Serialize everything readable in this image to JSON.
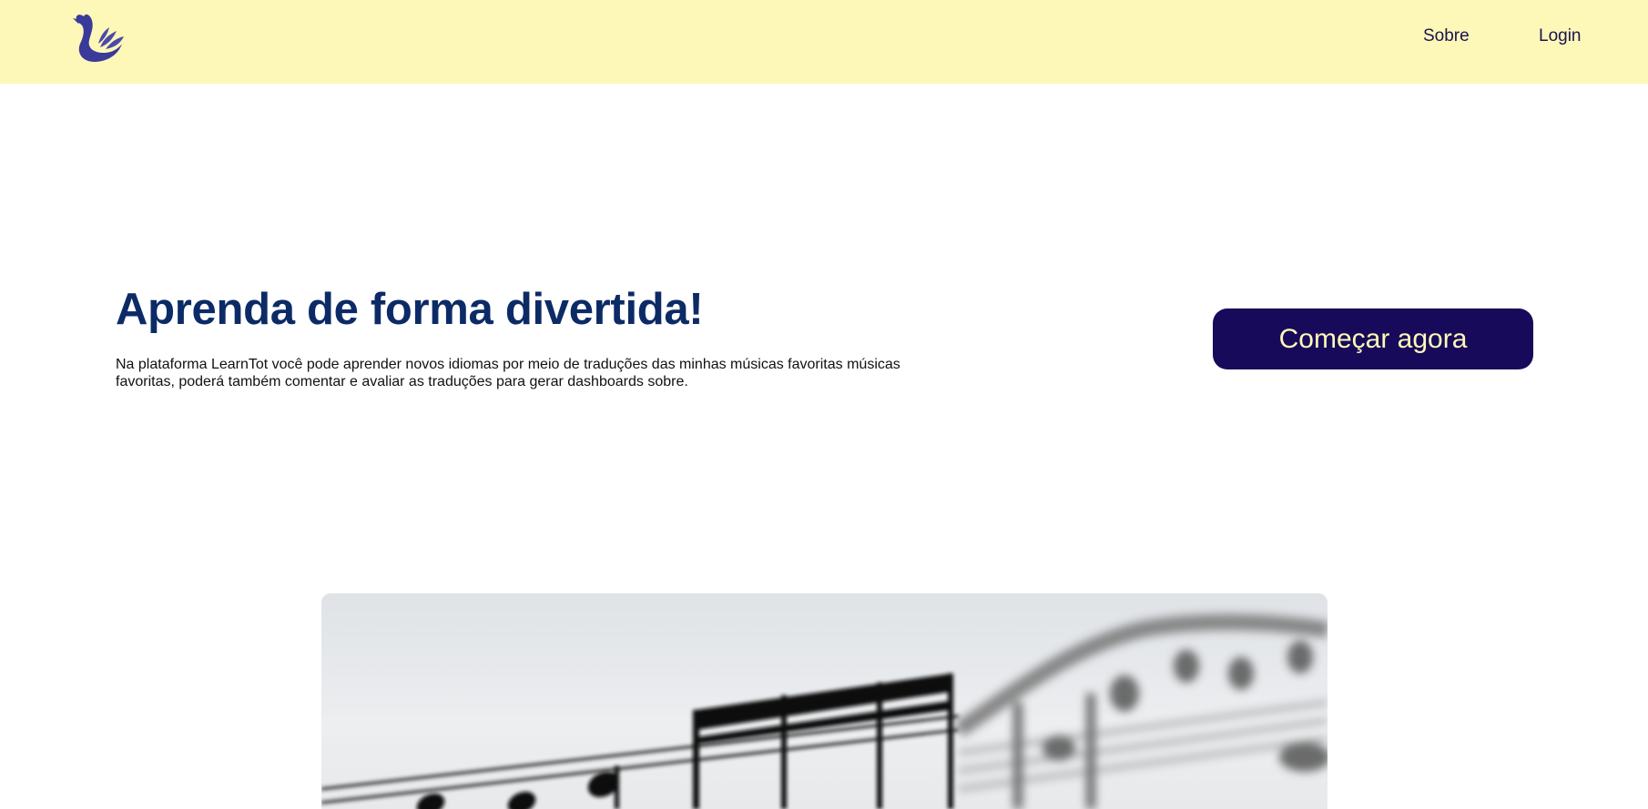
{
  "header": {
    "logo_icon": "swan-logo-icon",
    "nav": {
      "about_label": "Sobre",
      "login_label": "Login"
    }
  },
  "hero": {
    "title": "Aprenda de forma divertida!",
    "description": "Na plataforma LearnTot você pode aprender novos idiomas por meio de traduções das minhas músicas favoritas músicas favoritas, poderá também comentar e avaliar as traduções para gerar dashboards sobre.",
    "cta_label": "Começar agora"
  },
  "image": {
    "subject": "sheet-music-image"
  },
  "colors": {
    "header_bg": "#fef8b8",
    "title": "#0c2b66",
    "cta_bg": "#170a5a",
    "cta_text": "#fef8b8",
    "nav_text": "#1b1350",
    "logo": "#3a3a9a"
  }
}
